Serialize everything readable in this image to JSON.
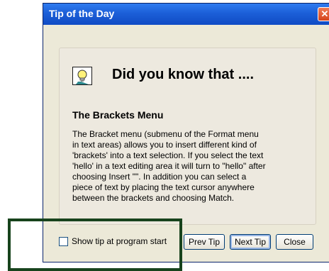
{
  "window": {
    "title": "Tip of the Day",
    "close_glyph": "✕",
    "close_icon": "close-icon"
  },
  "tip": {
    "icon": "lightbulb-icon",
    "headline": "Did you know that ....",
    "heading": "The Brackets Menu",
    "lines": [
      "The Bracket menu (submenu of the Format menu",
      "in text areas) allows you to insert different kind of",
      "'brackets' into a text selection. If you select the text",
      "'hello' in a text editing area it will turn to \"hello\" after",
      "choosing Insert \"\". In addition you can select a",
      "piece of text by placing the text cursor anywhere",
      "between the brackets and choosing Match."
    ]
  },
  "options": {
    "show_tip_label": "Show tip at program start",
    "show_tip_checked": false
  },
  "buttons": {
    "prev": "Prev Tip",
    "next": "Next Tip",
    "close": "Close"
  },
  "colors": {
    "titlebar": "#0f4bc4",
    "close_button": "#d4441c",
    "dialog_background": "#ece9d8",
    "highlight_box": "#17431c"
  }
}
